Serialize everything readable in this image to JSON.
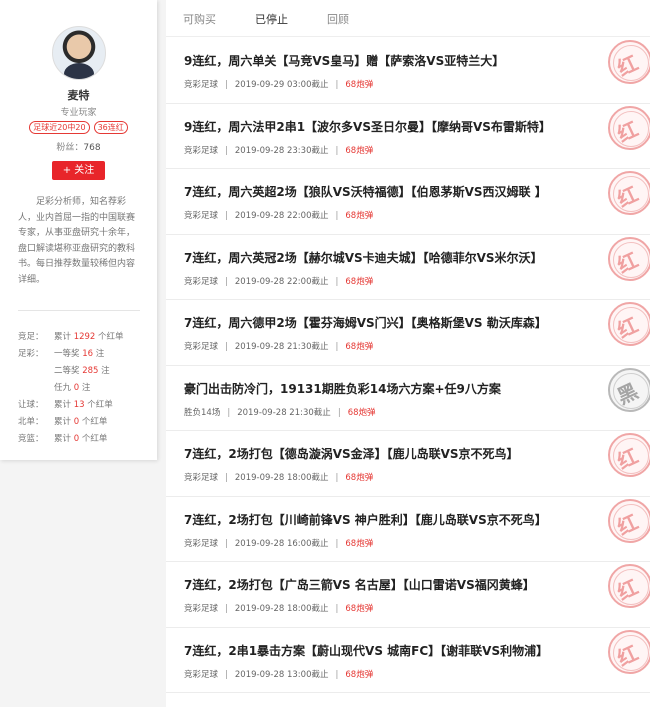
{
  "profile": {
    "name": "麦特",
    "role": "专业玩家",
    "badges": [
      "足球近20中20",
      "36连红"
    ],
    "fans_label": "粉丝：",
    "fans_count": "768",
    "follow_label": "+ 关注",
    "bio": "足彩分析师，知名荐彩人，业内首屈一指的中国联赛专家，从事亚盘研究十余年，盘口解读堪称亚盘研究的教科书。每日推荐数量较稀但内容详细。",
    "stats": [
      {
        "key": "竞足：",
        "pre": "累计 ",
        "num": "1292",
        "post": " 个红单"
      },
      {
        "key": "足彩：",
        "pre": "一等奖 ",
        "num": "16",
        "post": " 注"
      },
      {
        "key": "",
        "pre": "二等奖 ",
        "num": "285",
        "post": " 注"
      },
      {
        "key": "",
        "pre": "任九 ",
        "num": "0",
        "post": " 注"
      },
      {
        "key": "让球：",
        "pre": "累计 ",
        "num": "13",
        "post": " 个红单"
      },
      {
        "key": "北单：",
        "pre": "累计 ",
        "num": "0",
        "post": " 个红单"
      },
      {
        "key": "竞篮：",
        "pre": "累计 ",
        "num": "0",
        "post": " 个红单"
      }
    ]
  },
  "tabs": [
    "可购买",
    "已停止",
    "回顾"
  ],
  "active_tab": "已停止",
  "items": [
    {
      "title": "9连红，周六单关【马竞VS皇马】赠【萨索洛VS亚特兰大】",
      "category": "竞彩足球",
      "time": "2019-09-29 03:00截止",
      "price": "68炮弹",
      "stamp": "红"
    },
    {
      "title": "9连红，周六法甲2串1【波尔多VS圣日尔曼】【摩纳哥VS布雷斯特】",
      "category": "竞彩足球",
      "time": "2019-09-28 23:30截止",
      "price": "68炮弹",
      "stamp": "红"
    },
    {
      "title": "7连红，周六英超2场【狼队VS沃特福德】【伯恩茅斯VS西汉姆联 】",
      "category": "竞彩足球",
      "time": "2019-09-28 22:00截止",
      "price": "68炮弹",
      "stamp": "红"
    },
    {
      "title": "7连红，周六英冠2场【赫尔城VS卡迪夫城】【哈德菲尔VS米尔沃】",
      "category": "竞彩足球",
      "time": "2019-09-28 22:00截止",
      "price": "68炮弹",
      "stamp": "红"
    },
    {
      "title": "7连红，周六德甲2场【霍芬海姆VS门兴】【奥格斯堡VS 勒沃库森】",
      "category": "竞彩足球",
      "time": "2019-09-28 21:30截止",
      "price": "68炮弹",
      "stamp": "红"
    },
    {
      "title": "豪门出击防冷门，19131期胜负彩14场六方案+任9八方案",
      "category": "胜负14场",
      "time": "2019-09-28 21:30截止",
      "price": "68炮弹",
      "stamp": "黑"
    },
    {
      "title": "7连红，2场打包【德岛漩涡VS金泽】【鹿儿岛联VS京不死鸟】",
      "category": "竞彩足球",
      "time": "2019-09-28 18:00截止",
      "price": "68炮弹",
      "stamp": "红"
    },
    {
      "title": "7连红，2场打包【川崎前锋VS 神户胜利】【鹿儿岛联VS京不死鸟】",
      "category": "竞彩足球",
      "time": "2019-09-28 16:00截止",
      "price": "68炮弹",
      "stamp": "红"
    },
    {
      "title": "7连红，2场打包【广岛三箭VS 名古屋】【山口雷诺VS福冈黄蜂】",
      "category": "竞彩足球",
      "time": "2019-09-28 18:00截止",
      "price": "68炮弹",
      "stamp": "红"
    },
    {
      "title": "7连红，2串1暴击方案【蔚山现代VS 城南FC】【谢菲联VS利物浦】",
      "category": "竞彩足球",
      "time": "2019-09-28 13:00截止",
      "price": "68炮弹",
      "stamp": "红"
    }
  ]
}
